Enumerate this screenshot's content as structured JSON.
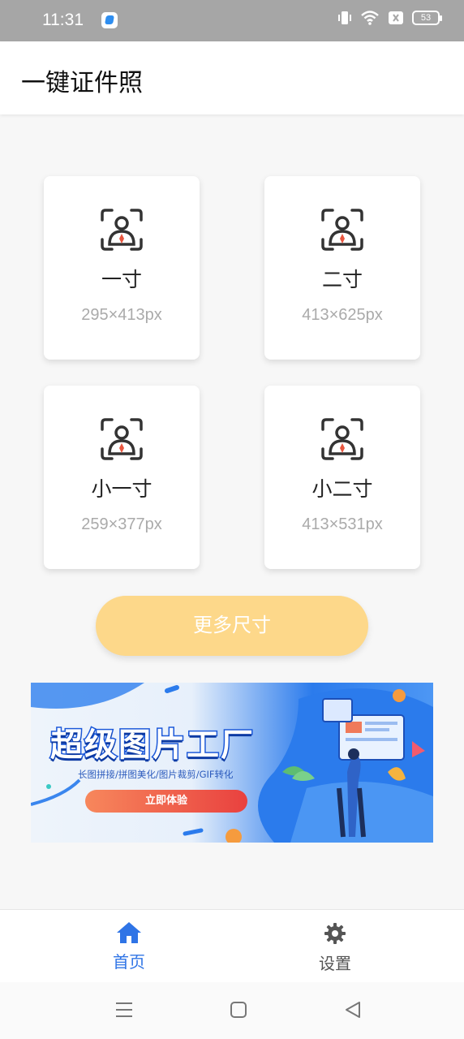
{
  "status_bar": {
    "time": "11:31",
    "battery": "53",
    "icons": [
      "app-notification-icon",
      "vibrate-icon",
      "wifi-icon",
      "sim-blocked-icon",
      "battery-icon"
    ]
  },
  "app_bar": {
    "title": "一键证件照"
  },
  "cards": [
    {
      "name": "一寸",
      "size": "295×413px",
      "icon": "portrait-frame-icon"
    },
    {
      "name": "二寸",
      "size": "413×625px",
      "icon": "portrait-frame-icon"
    },
    {
      "name": "小一寸",
      "size": "259×377px",
      "icon": "portrait-frame-icon"
    },
    {
      "name": "小二寸",
      "size": "413×531px",
      "icon": "portrait-frame-icon"
    }
  ],
  "more_button": {
    "label": "更多尺寸"
  },
  "banner": {
    "title": "超级图片工厂",
    "subtitle": "长图拼接/拼图美化/图片裁剪/GIF转化",
    "cta": "立即体验"
  },
  "bottom_nav": {
    "items": [
      {
        "label": "首页",
        "icon": "home-icon",
        "active": true
      },
      {
        "label": "设置",
        "icon": "gear-icon",
        "active": false
      }
    ]
  },
  "system_nav": [
    "menu-icon",
    "home-square-icon",
    "back-triangle-icon"
  ],
  "colors": {
    "accent": "#2f74e6",
    "more_button": "#fdd88a",
    "status_bar": "#a6a6a6",
    "icon_red": "#e8563f"
  }
}
